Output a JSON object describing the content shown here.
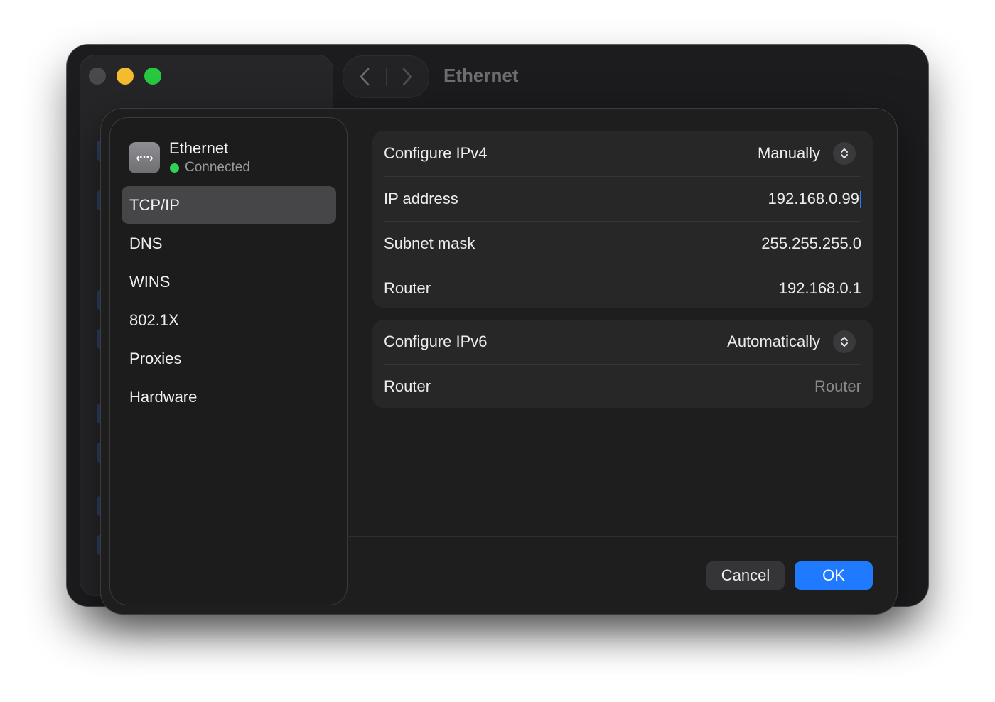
{
  "window": {
    "title": "Ethernet"
  },
  "device": {
    "name": "Ethernet",
    "status": "Connected",
    "icon": "ethernet-icon",
    "status_color": "#30d158"
  },
  "sidebar": {
    "items": [
      {
        "label": "TCP/IP",
        "selected": true
      },
      {
        "label": "DNS"
      },
      {
        "label": "WINS"
      },
      {
        "label": "802.1X"
      },
      {
        "label": "Proxies"
      },
      {
        "label": "Hardware"
      }
    ]
  },
  "ipv4": {
    "configure_label": "Configure IPv4",
    "configure_value": "Manually",
    "ip_label": "IP address",
    "ip_value": "192.168.0.99",
    "subnet_label": "Subnet mask",
    "subnet_value": "255.255.255.0",
    "router_label": "Router",
    "router_value": "192.168.0.1"
  },
  "ipv6": {
    "configure_label": "Configure IPv6",
    "configure_value": "Automatically",
    "router_label": "Router",
    "router_placeholder": "Router"
  },
  "buttons": {
    "cancel": "Cancel",
    "ok": "OK"
  },
  "colors": {
    "accent": "#1f7aff",
    "traffic_close": "#4a4a4c",
    "traffic_minimize": "#f5bd2e",
    "traffic_maximize": "#28c840"
  }
}
